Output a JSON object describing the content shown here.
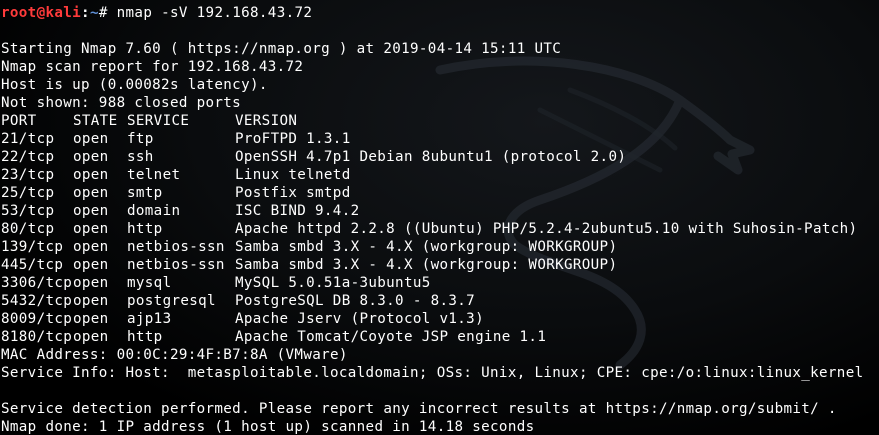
{
  "terminal": {
    "prompt": {
      "user_host": "root@kali",
      "colon": ":",
      "path": "~",
      "symbol": "# ",
      "command": "nmap -sV 192.168.43.72"
    },
    "header_lines": [
      "Starting Nmap 7.60 ( https://nmap.org ) at 2019-04-14 15:11 UTC",
      "Nmap scan report for 192.168.43.72",
      "Host is up (0.00082s latency).",
      "Not shown: 988 closed ports"
    ],
    "table": {
      "columns": [
        "PORT",
        "STATE",
        "SERVICE",
        "VERSION"
      ],
      "rows": [
        [
          "21/tcp",
          "open",
          "ftp",
          "ProFTPD 1.3.1"
        ],
        [
          "22/tcp",
          "open",
          "ssh",
          "OpenSSH 4.7p1 Debian 8ubuntu1 (protocol 2.0)"
        ],
        [
          "23/tcp",
          "open",
          "telnet",
          "Linux telnetd"
        ],
        [
          "25/tcp",
          "open",
          "smtp",
          "Postfix smtpd"
        ],
        [
          "53/tcp",
          "open",
          "domain",
          "ISC BIND 9.4.2"
        ],
        [
          "80/tcp",
          "open",
          "http",
          "Apache httpd 2.2.8 ((Ubuntu) PHP/5.2.4-2ubuntu5.10 with Suhosin-Patch)"
        ],
        [
          "139/tcp",
          "open",
          "netbios-ssn",
          "Samba smbd 3.X - 4.X (workgroup: WORKGROUP)"
        ],
        [
          "445/tcp",
          "open",
          "netbios-ssn",
          "Samba smbd 3.X - 4.X (workgroup: WORKGROUP)"
        ],
        [
          "3306/tcp",
          "open",
          "mysql",
          "MySQL 5.0.51a-3ubuntu5"
        ],
        [
          "5432/tcp",
          "open",
          "postgresql",
          "PostgreSQL DB 8.3.0 - 8.3.7"
        ],
        [
          "8009/tcp",
          "open",
          "ajp13",
          "Apache Jserv (Protocol v1.3)"
        ],
        [
          "8180/tcp",
          "open",
          "http",
          "Apache Tomcat/Coyote JSP engine 1.1"
        ]
      ]
    },
    "footer_lines": [
      "MAC Address: 00:0C:29:4F:B7:8A (VMware)",
      "Service Info: Host:  metasploitable.localdomain; OSs: Unix, Linux; CPE: cpe:/o:linux:linux_kernel",
      "",
      "Service detection performed. Please report any incorrect results at https://nmap.org/submit/ .",
      "Nmap done: 1 IP address (1 host up) scanned in 14.18 seconds"
    ],
    "colors": {
      "background": "#000000",
      "text": "#ffffff",
      "prompt_user": "#ff3b3b",
      "prompt_path": "#5f8ed4"
    },
    "wallpaper_icon": "kali-dragon-icon"
  }
}
